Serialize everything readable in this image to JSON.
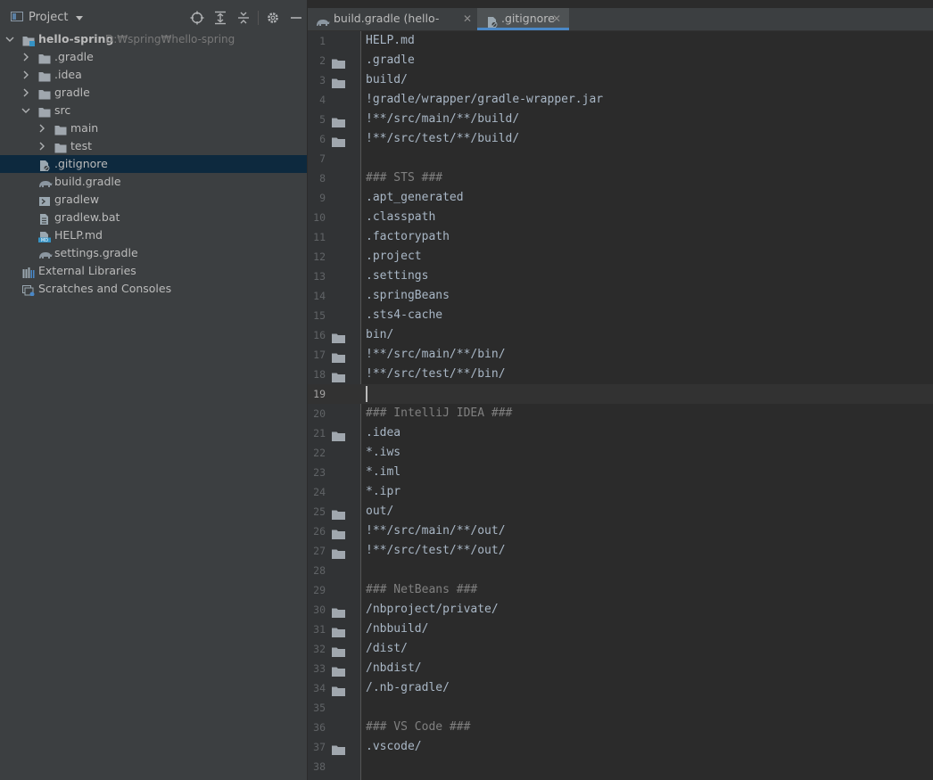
{
  "panel": {
    "title": "Project",
    "toolbar": [
      "locate-icon",
      "expand-all-icon",
      "collapse-all-icon",
      "gear-icon",
      "minimize-icon"
    ]
  },
  "tree": [
    {
      "label": "hello-spring",
      "path": "D:₩spring₩hello-spring",
      "indent": 0,
      "arrow": "down",
      "icon": "module-folder",
      "bold": true
    },
    {
      "label": ".gradle",
      "indent": 1,
      "arrow": "right",
      "icon": "folder"
    },
    {
      "label": ".idea",
      "indent": 1,
      "arrow": "right",
      "icon": "folder"
    },
    {
      "label": "gradle",
      "indent": 1,
      "arrow": "right",
      "icon": "folder"
    },
    {
      "label": "src",
      "indent": 1,
      "arrow": "down",
      "icon": "folder"
    },
    {
      "label": "main",
      "indent": 2,
      "arrow": "right",
      "icon": "folder"
    },
    {
      "label": "test",
      "indent": 2,
      "arrow": "right",
      "icon": "folder"
    },
    {
      "label": ".gitignore",
      "indent": 1,
      "arrow": "none",
      "icon": "gitignore-file",
      "selected": true
    },
    {
      "label": "build.gradle",
      "indent": 1,
      "arrow": "none",
      "icon": "gradle"
    },
    {
      "label": "gradlew",
      "indent": 1,
      "arrow": "none",
      "icon": "script-file"
    },
    {
      "label": "gradlew.bat",
      "indent": 1,
      "arrow": "none",
      "icon": "text-file"
    },
    {
      "label": "HELP.md",
      "indent": 1,
      "arrow": "none",
      "icon": "markdown-file"
    },
    {
      "label": "settings.gradle",
      "indent": 1,
      "arrow": "none",
      "icon": "gradle"
    },
    {
      "label": "External Libraries",
      "indent": 0,
      "arrow": "none",
      "icon": "libraries"
    },
    {
      "label": "Scratches and Consoles",
      "indent": 0,
      "arrow": "none",
      "icon": "scratches"
    }
  ],
  "tabs": [
    {
      "label": "build.gradle (hello-spring)",
      "icon": "gradle",
      "active": false
    },
    {
      "label": ".gitignore",
      "icon": "gitignore-file",
      "active": true
    }
  ],
  "editor": {
    "current_line": 19,
    "lines": [
      {
        "n": "1",
        "text": "HELP.md"
      },
      {
        "n": "2",
        "text": ".gradle",
        "fold": true
      },
      {
        "n": "3",
        "text": "build/",
        "fold": true
      },
      {
        "n": "4",
        "text": "!gradle/wrapper/gradle-wrapper.jar"
      },
      {
        "n": "5",
        "text": "!**/src/main/**/build/",
        "fold": true
      },
      {
        "n": "6",
        "text": "!**/src/test/**/build/",
        "fold": true
      },
      {
        "n": "7",
        "text": ""
      },
      {
        "n": "8",
        "text": "### STS ###",
        "comment": true
      },
      {
        "n": "9",
        "text": ".apt_generated"
      },
      {
        "n": "10",
        "text": ".classpath"
      },
      {
        "n": "11",
        "text": ".factorypath"
      },
      {
        "n": "12",
        "text": ".project"
      },
      {
        "n": "13",
        "text": ".settings"
      },
      {
        "n": "14",
        "text": ".springBeans"
      },
      {
        "n": "15",
        "text": ".sts4-cache"
      },
      {
        "n": "16",
        "text": "bin/",
        "fold": true
      },
      {
        "n": "17",
        "text": "!**/src/main/**/bin/",
        "fold": true
      },
      {
        "n": "18",
        "text": "!**/src/test/**/bin/",
        "fold": true
      },
      {
        "n": "19",
        "text": ""
      },
      {
        "n": "20",
        "text": "### IntelliJ IDEA ###",
        "comment": true
      },
      {
        "n": "21",
        "text": ".idea",
        "fold": true
      },
      {
        "n": "22",
        "text": "*.iws"
      },
      {
        "n": "23",
        "text": "*.iml"
      },
      {
        "n": "24",
        "text": "*.ipr"
      },
      {
        "n": "25",
        "text": "out/",
        "fold": true
      },
      {
        "n": "26",
        "text": "!**/src/main/**/out/",
        "fold": true
      },
      {
        "n": "27",
        "text": "!**/src/test/**/out/",
        "fold": true
      },
      {
        "n": "28",
        "text": ""
      },
      {
        "n": "29",
        "text": "### NetBeans ###",
        "comment": true
      },
      {
        "n": "30",
        "text": "/nbproject/private/",
        "fold": true
      },
      {
        "n": "31",
        "text": "/nbbuild/",
        "fold": true
      },
      {
        "n": "32",
        "text": "/dist/",
        "fold": true
      },
      {
        "n": "33",
        "text": "/nbdist/",
        "fold": true
      },
      {
        "n": "34",
        "text": "/.nb-gradle/",
        "fold": true
      },
      {
        "n": "35",
        "text": ""
      },
      {
        "n": "36",
        "text": "### VS Code ###",
        "comment": true
      },
      {
        "n": "37",
        "text": ".vscode/",
        "fold": true
      },
      {
        "n": "38",
        "text": ""
      }
    ]
  },
  "colors": {
    "panel_bg": "#3c3f41",
    "editor_bg": "#2b2b2b",
    "selection": "#0d293e",
    "folder": "#a0a7ae",
    "active_tab_underline": "#4a88c7",
    "code_text": "#a9b7c6",
    "comment_text": "#808080"
  }
}
